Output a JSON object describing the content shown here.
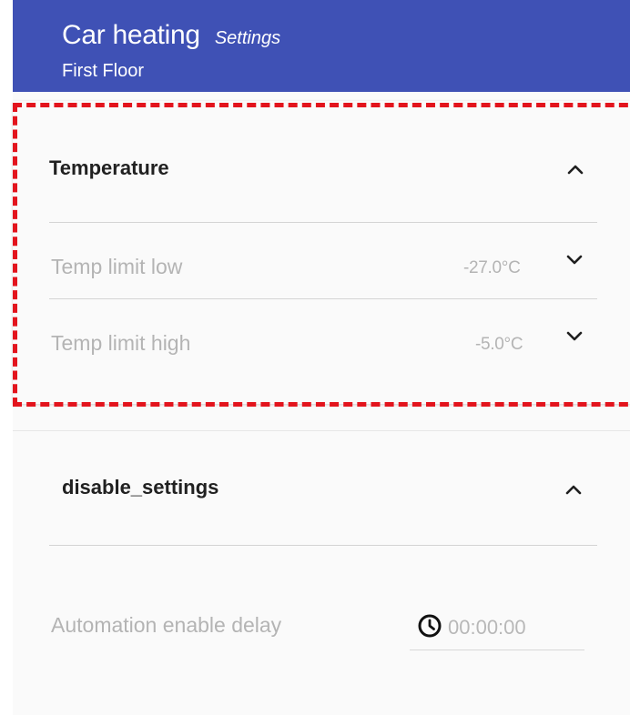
{
  "header": {
    "title": "Car heating",
    "subtitle": "Settings",
    "location": "First Floor",
    "background_color": "#3f51b5"
  },
  "temperature_section": {
    "title": "Temperature",
    "collapse_icon": "chevron-up-icon",
    "rows": [
      {
        "label": "Temp limit low",
        "value": "-27.0°C",
        "icon": "chevron-down-icon"
      },
      {
        "label": "Temp limit high",
        "value": "-5.0°C",
        "icon": "chevron-down-icon"
      }
    ]
  },
  "disable_section": {
    "title": "disable_settings",
    "collapse_icon": "chevron-up-icon",
    "automation_delay": {
      "label": "Automation enable delay",
      "value": "00:00:00",
      "icon": "clock-icon"
    }
  },
  "highlight": {
    "color": "#e3141d",
    "style": "dashed"
  }
}
